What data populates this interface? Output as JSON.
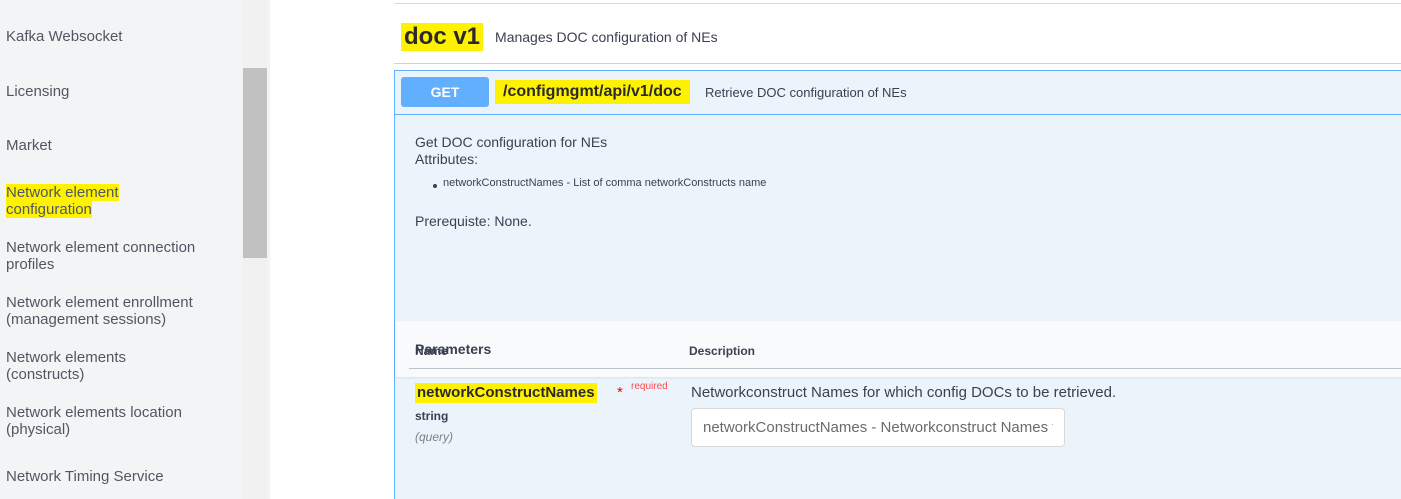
{
  "sidebar": {
    "items": [
      {
        "label": "Kafka Websocket"
      },
      {
        "label": "Licensing"
      },
      {
        "label": "Market"
      },
      {
        "label_line1": "Network element",
        "label_line2": "configuration"
      },
      {
        "label_line1": "Network element connection",
        "label_line2": "profiles"
      },
      {
        "label_line1": "Network element enrollment",
        "label_line2": "(management sessions)"
      },
      {
        "label_line1": "Network elements",
        "label_line2": "(constructs)"
      },
      {
        "label_line1": "Network elements location",
        "label_line2": "(physical)"
      },
      {
        "label": "Network Timing Service"
      }
    ]
  },
  "tag": {
    "name": "doc v1",
    "description": "Manages DOC configuration of NEs"
  },
  "operation": {
    "method": "GET",
    "path": "/configmgmt/api/v1/doc",
    "summary": "Retrieve DOC configuration of NEs",
    "description_line1": "Get DOC configuration for NEs",
    "description_line2": "Attributes:",
    "bullet": "networkConstructNames - List of comma networkConstructs name",
    "prerequisite": "Prerequiste: None."
  },
  "parameters": {
    "title": "Parameters",
    "col_name": "Name",
    "col_description": "Description",
    "items": [
      {
        "name": "networkConstructNames",
        "required_star": "*",
        "required_label": "required",
        "type": "string",
        "in": "(query)",
        "description": "Networkconstruct Names for which config DOCs to be retrieved.",
        "placeholder": "networkConstructNames - Networkconstruct Names for which config DOCs to be retrieved."
      }
    ]
  },
  "colors": {
    "highlight": "#fff200",
    "get_method": "#61affe",
    "op_background": "#ebf3fb",
    "sidebar_background": "#f3f4f6"
  }
}
